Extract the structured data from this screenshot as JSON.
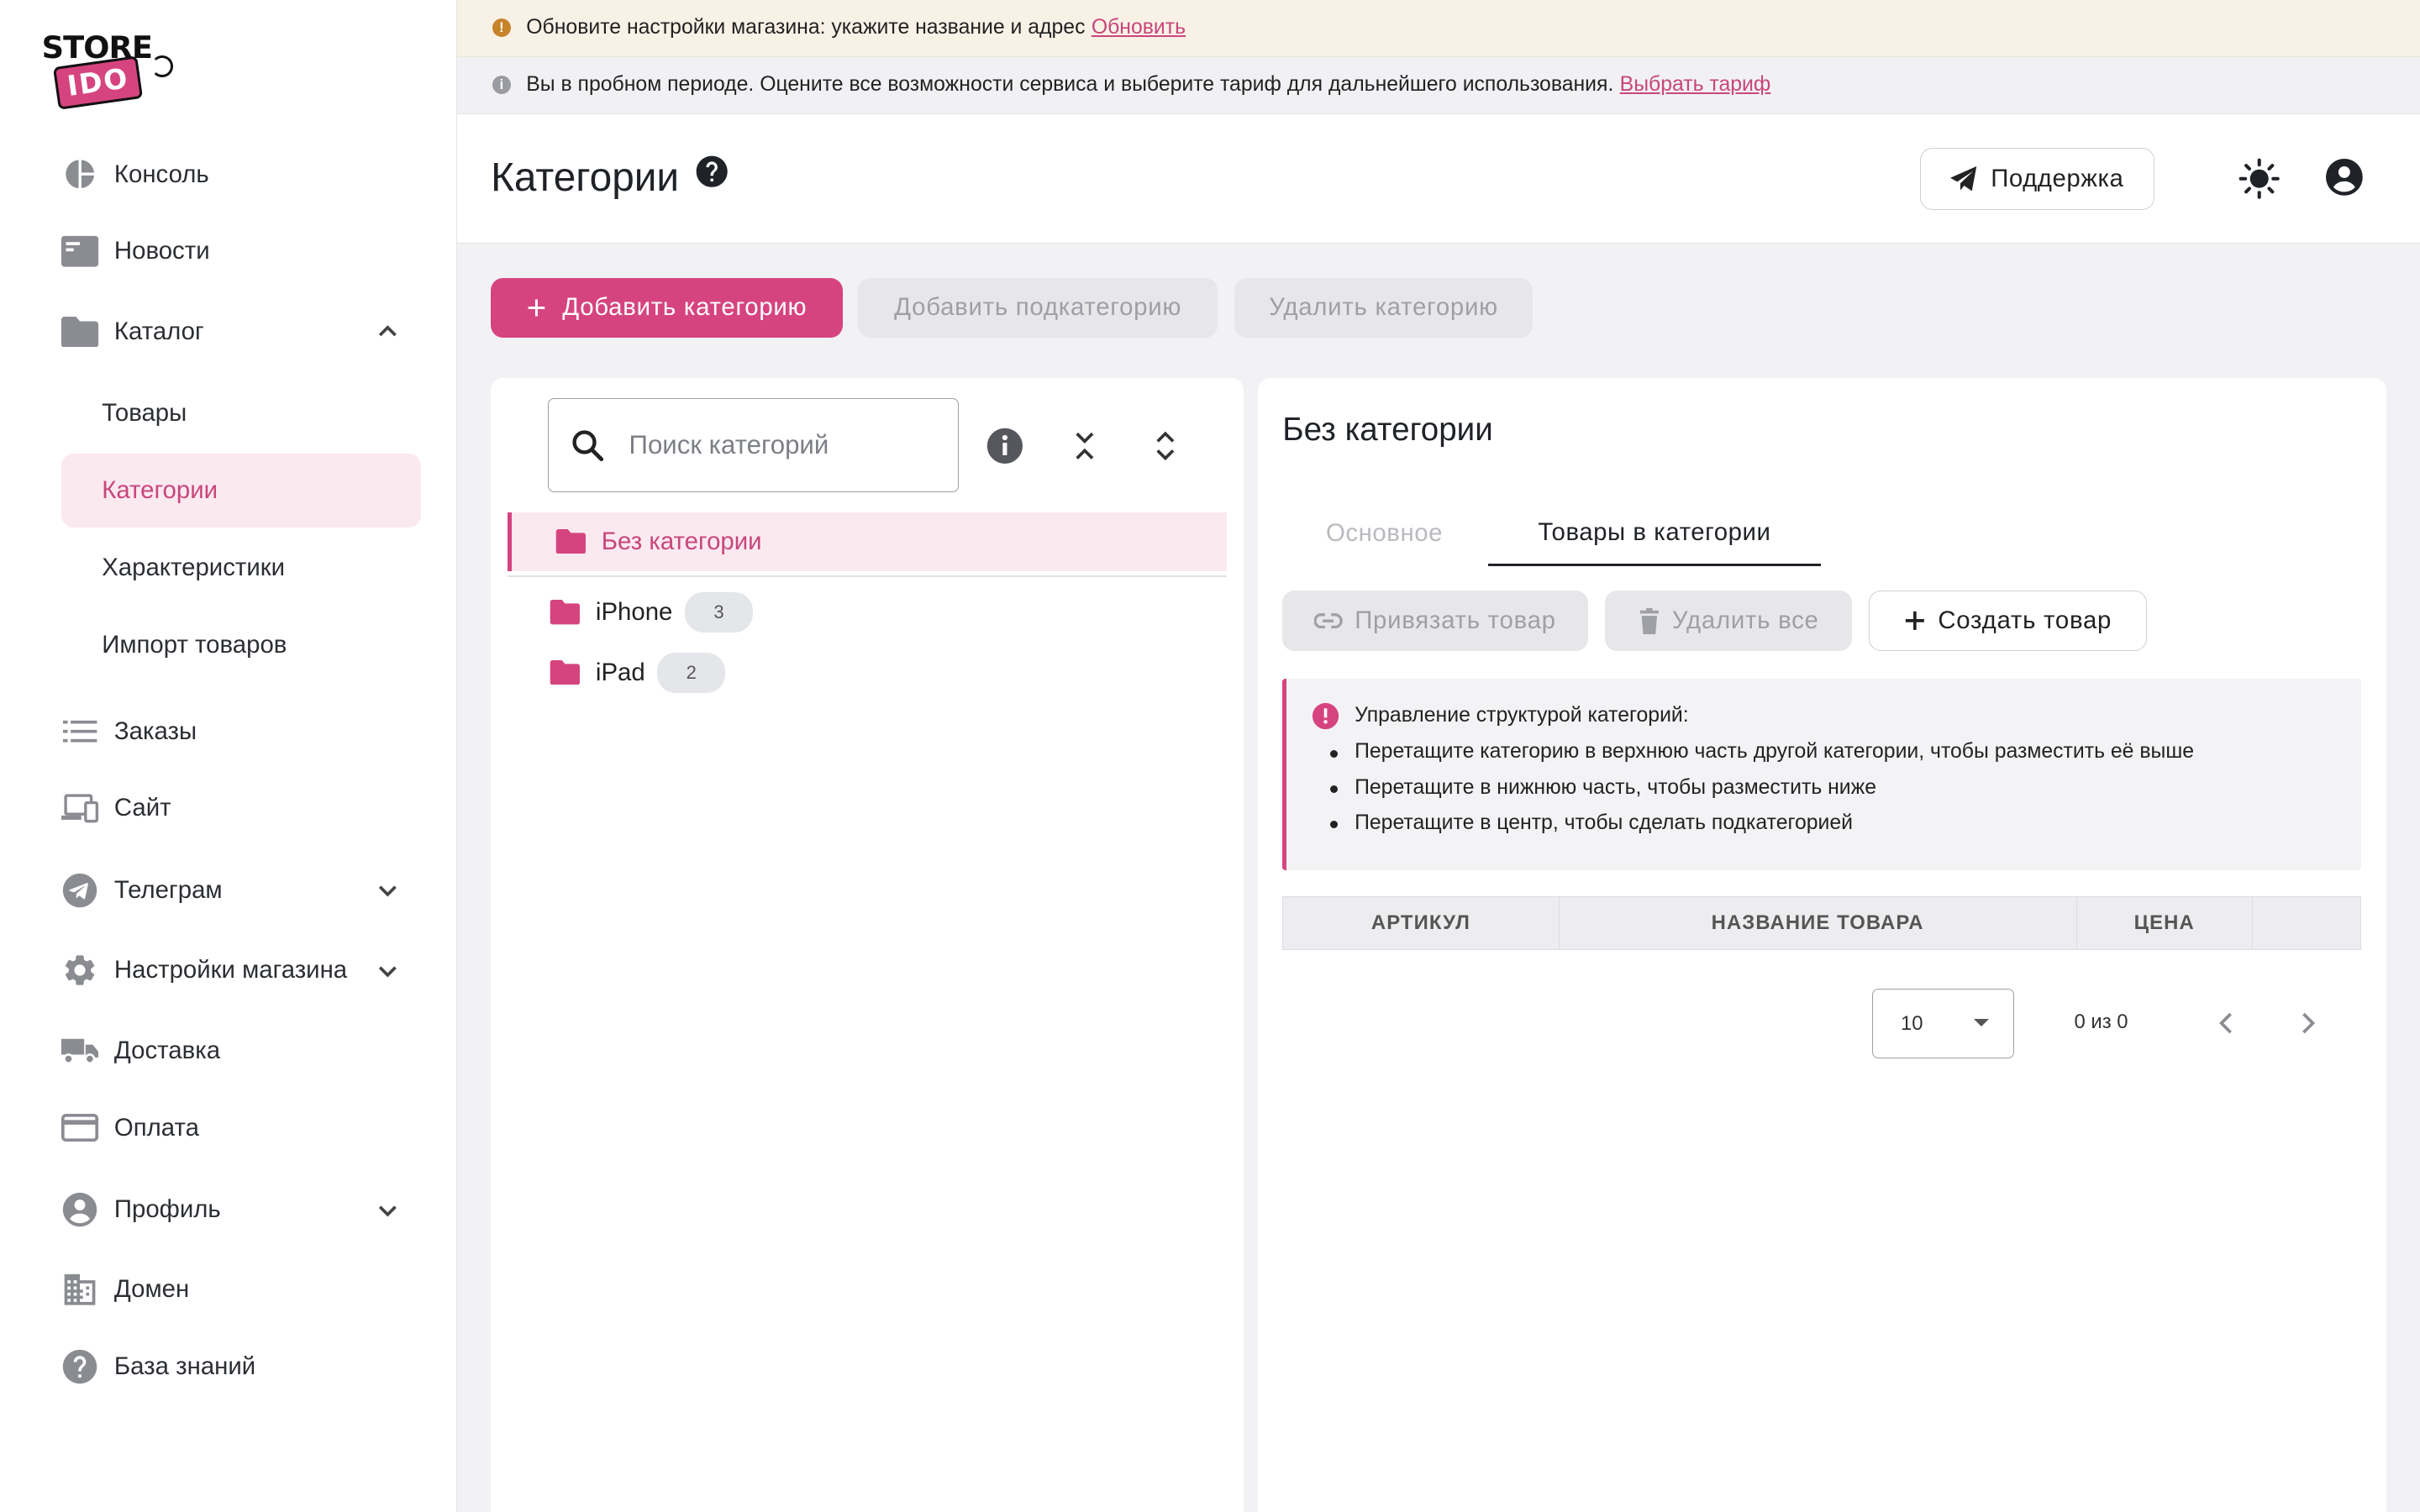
{
  "logo": {
    "line1": "STORE",
    "line2": "IDO"
  },
  "sidebar": {
    "items": [
      {
        "label": "Консоль",
        "icon": "pie-chart-icon"
      },
      {
        "label": "Новости",
        "icon": "news-icon"
      },
      {
        "label": "Каталог",
        "icon": "folder-icon",
        "expanded": true
      },
      {
        "label": "Заказы",
        "icon": "list-icon"
      },
      {
        "label": "Сайт",
        "icon": "devices-icon"
      },
      {
        "label": "Телеграм",
        "icon": "telegram-icon"
      },
      {
        "label": "Настройки магазина",
        "icon": "gear-icon"
      },
      {
        "label": "Доставка",
        "icon": "truck-icon"
      },
      {
        "label": "Оплата",
        "icon": "credit-card-icon"
      },
      {
        "label": "Профиль",
        "icon": "account-icon"
      },
      {
        "label": "Домен",
        "icon": "domain-icon"
      },
      {
        "label": "База знаний",
        "icon": "help-icon"
      }
    ],
    "catalog_sub": [
      "Товары",
      "Категории",
      "Характеристики",
      "Импорт товаров"
    ],
    "active_sub": "Категории"
  },
  "banners": {
    "warning_text": "Обновите настройки магазина: укажите название и адрес",
    "warning_link": "Обновить",
    "trial_text": "Вы в пробном периоде. Оцените все возможности сервиса и выберите тариф для дальнейшего использования.",
    "trial_link": "Выбрать тариф"
  },
  "header": {
    "title": "Категории",
    "support_label": "Поддержка"
  },
  "actions": {
    "add_category": "Добавить категорию",
    "add_subcategory": "Добавить подкатегорию",
    "delete_category": "Удалить категорию"
  },
  "tree": {
    "search_placeholder": "Поиск категорий",
    "items": [
      {
        "label": "Без категории",
        "count": "",
        "active": true
      },
      {
        "label": "iPhone",
        "count": "3"
      },
      {
        "label": "iPad",
        "count": "2"
      }
    ]
  },
  "detail": {
    "title": "Без категории",
    "tabs": [
      "Основное",
      "Товары в категории"
    ],
    "active_tab": "Товары в категории",
    "buttons": {
      "link_product": "Привязать товар",
      "delete_all": "Удалить все",
      "create_product": "Создать товар"
    },
    "info": {
      "heading": "Управление структурой категорий:",
      "bullets": [
        "Перетащите категорию в верхнюю часть другой категории, чтобы разместить её выше",
        "Перетащите в нижнюю часть, чтобы разместить ниже",
        "Перетащите в центр, чтобы сделать подкатегорией"
      ]
    },
    "table": {
      "columns": [
        "АРТИКУЛ",
        "НАЗВАНИЕ ТОВАРА",
        "ЦЕНА",
        ""
      ]
    },
    "pager": {
      "page_size": "10",
      "info": "0 из 0"
    }
  },
  "colors": {
    "accent": "#d6447f",
    "accent_bg": "#fbe9f0",
    "warning_icon": "#c7832a"
  }
}
